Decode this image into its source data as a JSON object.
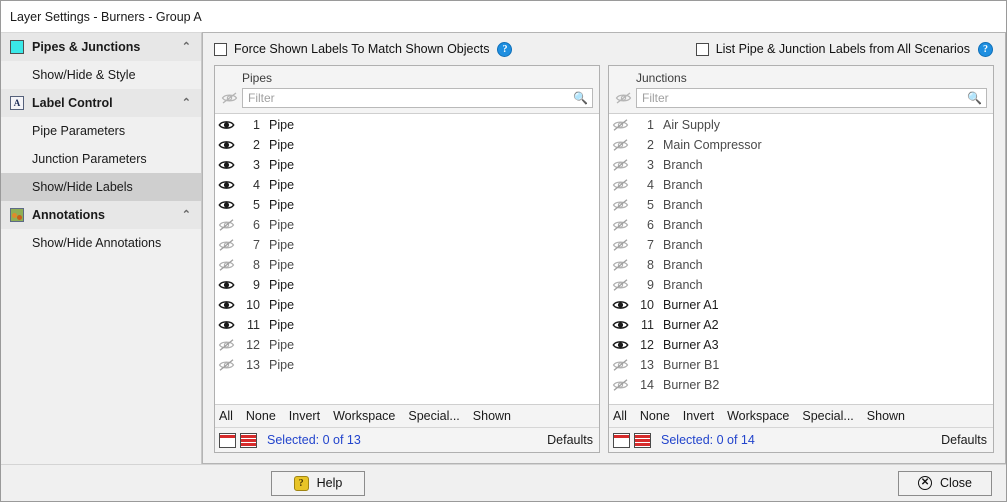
{
  "window": {
    "title": "Layer Settings - Burners - Group A"
  },
  "sidebar": {
    "groups": [
      {
        "label": "Pipes & Junctions",
        "icon": "pipes-square-icon",
        "chevron": "⌃",
        "items": [
          {
            "label": "Show/Hide & Style",
            "selected": false
          }
        ]
      },
      {
        "label": "Label Control",
        "icon": "label-a-icon",
        "chevron": "⌃",
        "items": [
          {
            "label": "Pipe Parameters",
            "selected": false
          },
          {
            "label": "Junction Parameters",
            "selected": false
          },
          {
            "label": "Show/Hide Labels",
            "selected": true
          }
        ]
      },
      {
        "label": "Annotations",
        "icon": "annotations-image-icon",
        "chevron": "⌃",
        "items": [
          {
            "label": "Show/Hide Annotations",
            "selected": false
          }
        ]
      }
    ]
  },
  "topbar": {
    "force_match": {
      "label": "Force Shown Labels To Match Shown Objects",
      "checked": false,
      "help": "?"
    },
    "all_scenarios": {
      "label": "List Pipe & Junction Labels from All Scenarios",
      "checked": false,
      "help": "?"
    }
  },
  "pipes_panel": {
    "title": "Pipes",
    "filter_placeholder": "Filter",
    "filter_value": "",
    "search_icon": "search-icon",
    "header_eye": "eye-hidden-icon",
    "actions": [
      "All",
      "None",
      "Invert",
      "Workspace",
      "Special...",
      "Shown"
    ],
    "selected_text": "Selected: 0 of 13",
    "defaults_label": "Defaults",
    "rows": [
      {
        "num": "1",
        "name": "Pipe",
        "visible": true
      },
      {
        "num": "2",
        "name": "Pipe",
        "visible": true
      },
      {
        "num": "3",
        "name": "Pipe",
        "visible": true
      },
      {
        "num": "4",
        "name": "Pipe",
        "visible": true
      },
      {
        "num": "5",
        "name": "Pipe",
        "visible": true
      },
      {
        "num": "6",
        "name": "Pipe",
        "visible": false
      },
      {
        "num": "7",
        "name": "Pipe",
        "visible": false
      },
      {
        "num": "8",
        "name": "Pipe",
        "visible": false
      },
      {
        "num": "9",
        "name": "Pipe",
        "visible": true
      },
      {
        "num": "10",
        "name": "Pipe",
        "visible": true
      },
      {
        "num": "11",
        "name": "Pipe",
        "visible": true
      },
      {
        "num": "12",
        "name": "Pipe",
        "visible": false
      },
      {
        "num": "13",
        "name": "Pipe",
        "visible": false
      }
    ]
  },
  "junctions_panel": {
    "title": "Junctions",
    "filter_placeholder": "Filter",
    "filter_value": "",
    "search_icon": "search-icon",
    "header_eye": "eye-hidden-icon",
    "actions": [
      "All",
      "None",
      "Invert",
      "Workspace",
      "Special...",
      "Shown"
    ],
    "selected_text": "Selected: 0 of 14",
    "defaults_label": "Defaults",
    "rows": [
      {
        "num": "1",
        "name": "Air Supply",
        "visible": false
      },
      {
        "num": "2",
        "name": "Main Compressor",
        "visible": false
      },
      {
        "num": "3",
        "name": "Branch",
        "visible": false
      },
      {
        "num": "4",
        "name": "Branch",
        "visible": false
      },
      {
        "num": "5",
        "name": "Branch",
        "visible": false
      },
      {
        "num": "6",
        "name": "Branch",
        "visible": false
      },
      {
        "num": "7",
        "name": "Branch",
        "visible": false
      },
      {
        "num": "8",
        "name": "Branch",
        "visible": false
      },
      {
        "num": "9",
        "name": "Branch",
        "visible": false
      },
      {
        "num": "10",
        "name": "Burner A1",
        "visible": true
      },
      {
        "num": "11",
        "name": "Burner A2",
        "visible": true
      },
      {
        "num": "12",
        "name": "Burner A3",
        "visible": true
      },
      {
        "num": "13",
        "name": "Burner B1",
        "visible": false
      },
      {
        "num": "14",
        "name": "Burner B2",
        "visible": false
      }
    ]
  },
  "bottombar": {
    "help_label": "Help",
    "close_label": "Close"
  },
  "colors": {
    "accent_link": "#2244cc",
    "pipes_icon": "#3ae8e8",
    "help_blue": "#1f8fe0",
    "mini_icon_red": "#d62b2b"
  }
}
